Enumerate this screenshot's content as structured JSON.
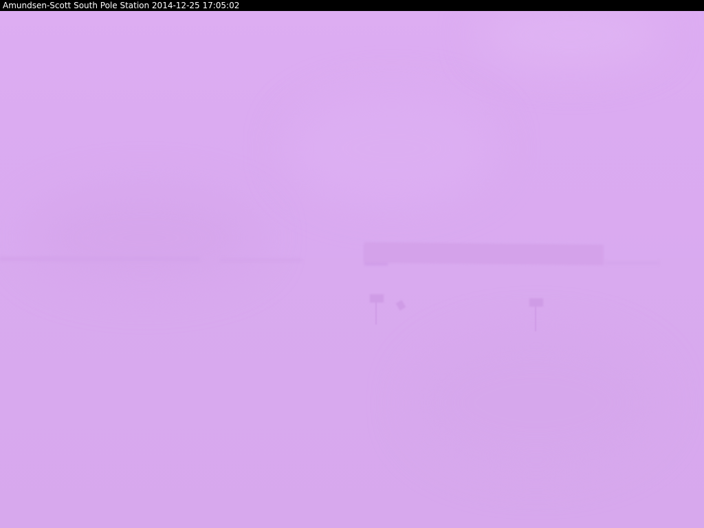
{
  "caption": {
    "text": "Amundsen-Scott South Pole Station 2014-12-25 17:05:02"
  },
  "scene": {
    "description_colors": {
      "sky": "#ddadf2",
      "ground": "#d8a9ee",
      "structure": "#d4a2ea",
      "caption_background": "#000000",
      "caption_text": "#ffffff"
    }
  }
}
